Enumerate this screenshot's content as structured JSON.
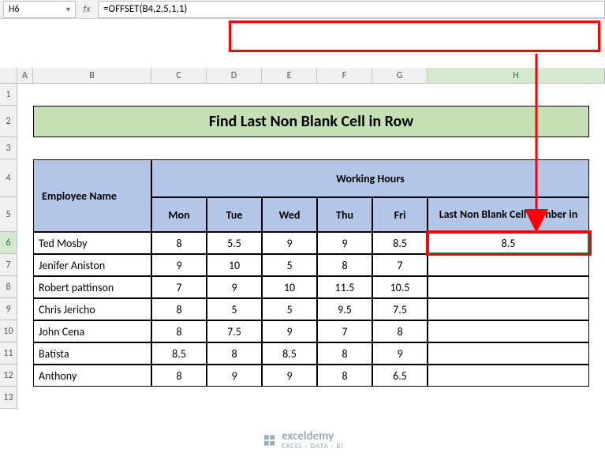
{
  "namebox": "H6",
  "fx_label": "fx",
  "formula": "=OFFSET(B4,2,5,1,1)",
  "columns": [
    "A",
    "B",
    "C",
    "D",
    "E",
    "F",
    "G",
    "H"
  ],
  "rows": [
    "1",
    "2",
    "3",
    "4",
    "5",
    "6",
    "7",
    "8",
    "9",
    "10",
    "11",
    "12",
    "13"
  ],
  "title": "Find Last Non Blank Cell in Row",
  "headers": {
    "employee": "Employee Name",
    "working_hours": "Working Hours",
    "mon": "Mon",
    "tue": "Tue",
    "wed": "Wed",
    "thu": "Thu",
    "fri": "Fri",
    "last": "Last Non Blank Cell Number in"
  },
  "data": [
    {
      "name": "Ted Mosby",
      "mon": "8",
      "tue": "5.5",
      "wed": "9",
      "thu": "9",
      "fri": "8.5",
      "last": "8.5"
    },
    {
      "name": "Jenifer Aniston",
      "mon": "9",
      "tue": "10",
      "wed": "5",
      "thu": "8",
      "fri": "7",
      "last": ""
    },
    {
      "name": "Robert pattinson",
      "mon": "7",
      "tue": "9",
      "wed": "10",
      "thu": "11.5",
      "fri": "10.5",
      "last": ""
    },
    {
      "name": "Chris Jericho",
      "mon": "8",
      "tue": "5",
      "wed": "5",
      "thu": "9.5",
      "fri": "7.5",
      "last": ""
    },
    {
      "name": "John Cena",
      "mon": "8",
      "tue": "7.5",
      "wed": "9",
      "thu": "7",
      "fri": "8",
      "last": ""
    },
    {
      "name": "Batista",
      "mon": "8.5",
      "tue": "8",
      "wed": "8.5",
      "thu": "8",
      "fri": "9",
      "last": ""
    },
    {
      "name": "Anthony",
      "mon": "8",
      "tue": "9",
      "wed": "9",
      "thu": "8",
      "fri": "6.5",
      "last": ""
    }
  ],
  "logo": {
    "text": "exceldemy",
    "sub": "EXCEL · DATA · BI"
  }
}
